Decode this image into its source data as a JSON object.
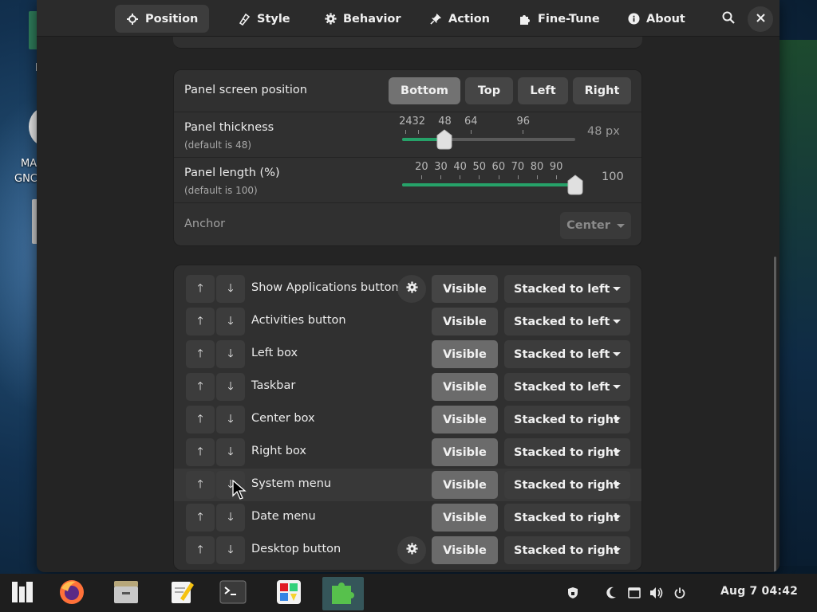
{
  "desktop": {
    "icon_label_partial_1": "MA",
    "icon_label_partial_2": "GNC",
    "icon_label_partial_top": "I"
  },
  "header": {
    "tabs": [
      {
        "label": "Position",
        "icon": "crosshair-icon",
        "active": true
      },
      {
        "label": "Style",
        "icon": "paint-brush-icon",
        "active": false
      },
      {
        "label": "Behavior",
        "icon": "gear-icon",
        "active": false
      },
      {
        "label": "Action",
        "icon": "pin-icon",
        "active": false
      },
      {
        "label": "Fine-Tune",
        "icon": "puzzle-icon",
        "active": false
      },
      {
        "label": "About",
        "icon": "info-icon",
        "active": false
      }
    ],
    "search_icon": "search-icon",
    "close_icon": "close-icon"
  },
  "panel_settings": {
    "screen_position": {
      "label": "Panel screen position",
      "options": [
        "Bottom",
        "Top",
        "Left",
        "Right"
      ],
      "selected": "Bottom"
    },
    "thickness": {
      "label": "Panel thickness",
      "default_text": "(default is 48)",
      "marks": [
        "24",
        "32",
        "48",
        "64",
        "96"
      ],
      "value": 48,
      "min": 22,
      "max": 128,
      "value_text": "48 px"
    },
    "length": {
      "label": "Panel length (%)",
      "default_text": "(default is 100)",
      "marks": [
        "20",
        "30",
        "40",
        "50",
        "60",
        "70",
        "80",
        "90"
      ],
      "value": 100,
      "min": 10,
      "max": 100,
      "value_text": "100"
    },
    "anchor": {
      "label": "Anchor",
      "value": "Center"
    }
  },
  "elements": [
    {
      "name": "Show Applications button",
      "has_settings": true,
      "visibility": "Visible",
      "visible_on": false,
      "position": "Stacked to left"
    },
    {
      "name": "Activities button",
      "has_settings": false,
      "visibility": "Visible",
      "visible_on": false,
      "position": "Stacked to left"
    },
    {
      "name": "Left box",
      "has_settings": false,
      "visibility": "Visible",
      "visible_on": true,
      "position": "Stacked to left"
    },
    {
      "name": "Taskbar",
      "has_settings": false,
      "visibility": "Visible",
      "visible_on": true,
      "position": "Stacked to left"
    },
    {
      "name": "Center box",
      "has_settings": false,
      "visibility": "Visible",
      "visible_on": true,
      "position": "Stacked to right"
    },
    {
      "name": "Right box",
      "has_settings": false,
      "visibility": "Visible",
      "visible_on": true,
      "position": "Stacked to right"
    },
    {
      "name": "System menu",
      "has_settings": false,
      "visibility": "Visible",
      "visible_on": true,
      "position": "Stacked to right"
    },
    {
      "name": "Date menu",
      "has_settings": false,
      "visibility": "Visible",
      "visible_on": true,
      "position": "Stacked to right"
    },
    {
      "name": "Desktop button",
      "has_settings": true,
      "visibility": "Visible",
      "visible_on": true,
      "position": "Stacked to right"
    }
  ],
  "taskbar": {
    "apps": [
      {
        "name": "menu-icon"
      },
      {
        "name": "firefox-icon"
      },
      {
        "name": "files-icon"
      },
      {
        "name": "text-editor-icon"
      },
      {
        "name": "terminal-icon"
      },
      {
        "name": "software-icon"
      },
      {
        "name": "extensions-icon",
        "active": true
      }
    ],
    "tray": [
      "shield-icon",
      "moon-icon",
      "screen-icon",
      "volume-icon",
      "power-icon"
    ],
    "clock": "Aug 7  04:42"
  },
  "colors": {
    "accent_green": "#26a269",
    "window_bg": "#242424",
    "card_bg": "#303030"
  }
}
